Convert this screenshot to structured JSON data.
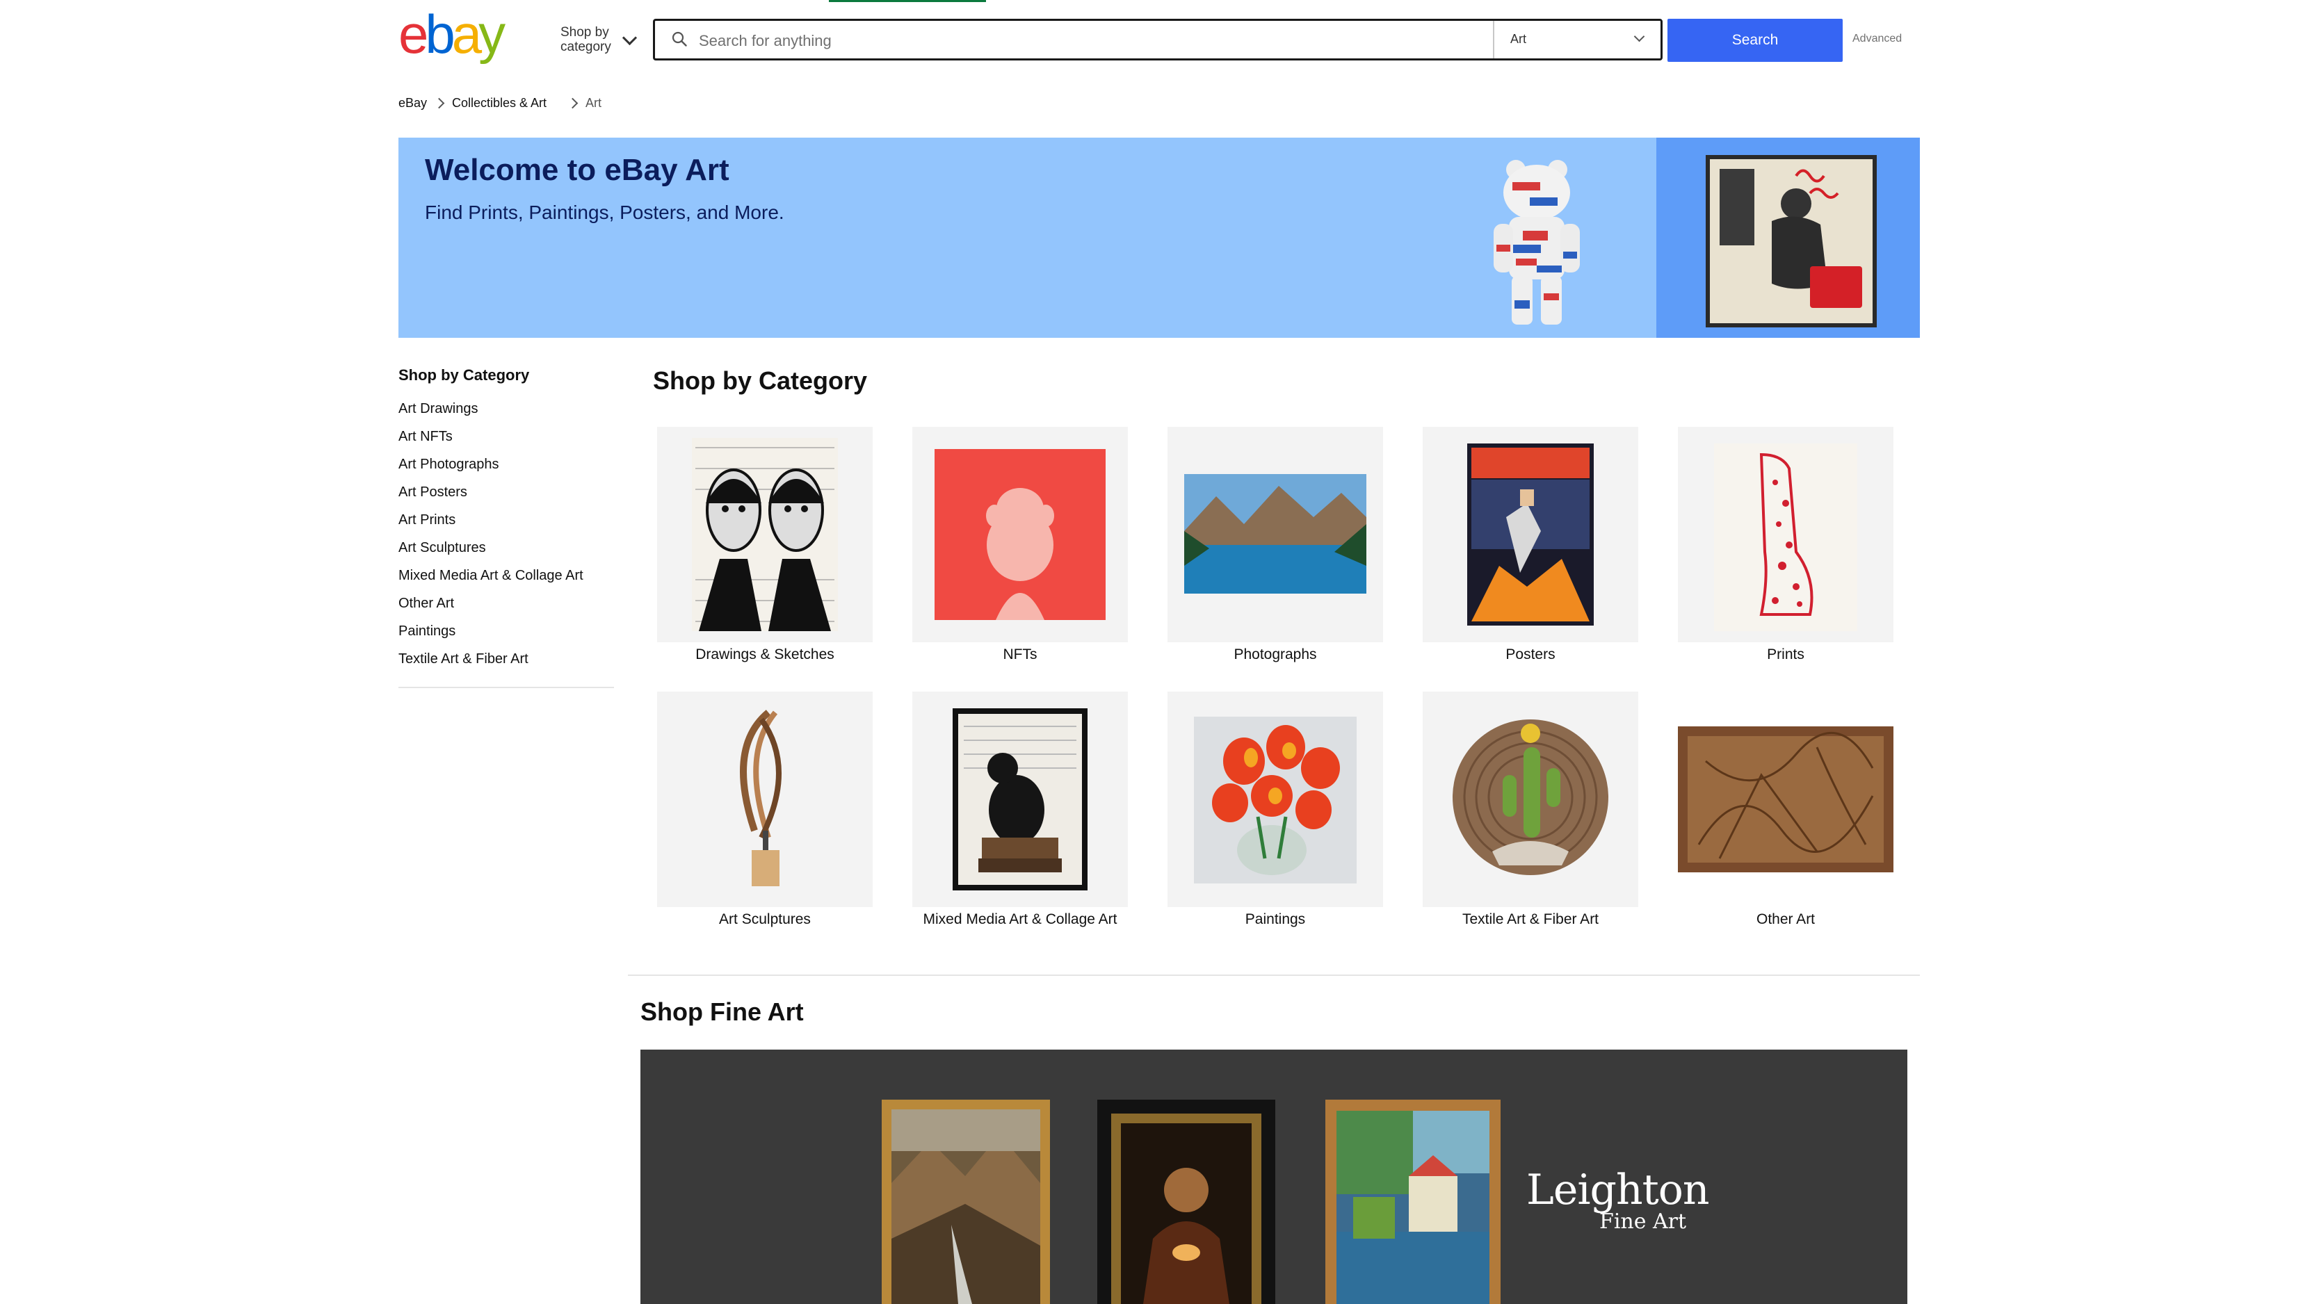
{
  "header": {
    "logo_text": "ebay",
    "shop_by_category": [
      "Shop by",
      "category"
    ],
    "search_placeholder": "Search for anything",
    "category_select": "Art",
    "search_button": "Search",
    "advanced_link": "Advanced"
  },
  "breadcrumb": [
    "eBay",
    "Collectibles & Art",
    "Art"
  ],
  "hero": {
    "title": "Welcome to eBay Art",
    "subtitle": "Find Prints, Paintings, Posters, and More."
  },
  "sidebar": {
    "heading": "Shop by Category",
    "items": [
      "Art Drawings",
      "Art NFTs",
      "Art Photographs",
      "Art Posters",
      "Art Prints",
      "Art Sculptures",
      "Mixed Media Art & Collage Art",
      "Other Art",
      "Paintings",
      "Textile Art & Fiber Art"
    ]
  },
  "main": {
    "heading": "Shop by Category",
    "tiles": [
      "Drawings & Sketches",
      "NFTs",
      "Photographs",
      "Posters",
      "Prints",
      "Art Sculptures",
      "Mixed Media Art & Collage Art",
      "Paintings",
      "Textile Art & Fiber Art",
      "Other Art"
    ]
  },
  "fine_art": {
    "heading": "Shop Fine Art",
    "brand": "Leighton",
    "brand_sub": "Fine Art"
  },
  "colors": {
    "accent_blue": "#3665f3",
    "hero_blue": "#93c5fd",
    "hero_dark": "#0b1d5c",
    "ebay_red": "#e53238",
    "ebay_blue": "#0064d2",
    "ebay_yellow": "#f5af02",
    "ebay_green": "#86b817"
  }
}
